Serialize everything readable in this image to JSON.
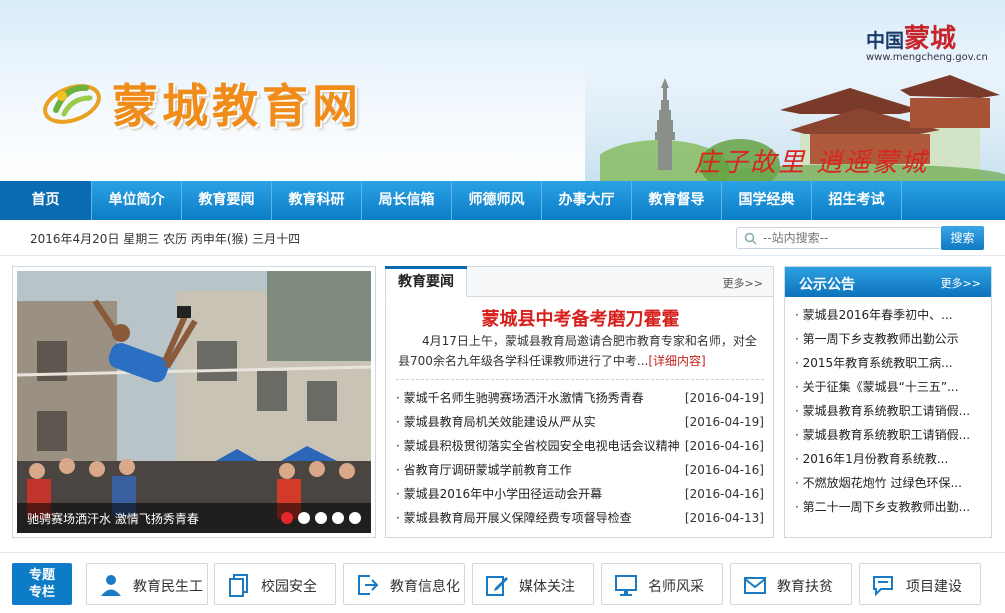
{
  "header": {
    "site_title": "蒙城教育网",
    "china_logo_prefix": "中国",
    "china_logo_name": "蒙城",
    "china_logo_url": "www.mengcheng.gov.cn",
    "slogan": "庄子故里  逍遥蒙城"
  },
  "nav": {
    "items": [
      "首页",
      "单位简介",
      "教育要闻",
      "教育科研",
      "局长信箱",
      "师德师风",
      "办事大厅",
      "教育督导",
      "国学经典",
      "招生考试"
    ],
    "active": "首页"
  },
  "datebar": {
    "date_text": "2016年4月20日 星期三 农历 丙申年(猴) 三月十四",
    "search_placeholder": "--站内搜索--",
    "search_button": "搜索"
  },
  "slideshow": {
    "caption": "驰骋赛场洒汗水 激情飞扬秀青春",
    "slide_count": 5,
    "active_slide": 1
  },
  "news": {
    "tab_label": "教育要闻",
    "more_label": "更多>>",
    "headline": "蒙城县中考备考磨刀霍霍",
    "summary": "4月17日上午，蒙城县教育局邀请合肥市教育专家和名师，对全县700余名九年级各学科任课教师进行了中考...",
    "detail_link": "[详细内容]",
    "items": [
      {
        "title": "蒙城千名师生驰骋赛场洒汗水激情飞扬秀青春",
        "date": "[2016-04-19]"
      },
      {
        "title": "蒙城县教育局机关效能建设从严从实",
        "date": "[2016-04-19]"
      },
      {
        "title": "蒙城县积极贯彻落实全省校园安全电视电话会议精神",
        "date": "[2016-04-16]"
      },
      {
        "title": "省教育厅调研蒙城学前教育工作",
        "date": "[2016-04-16]"
      },
      {
        "title": "蒙城县2016年中小学田径运动会开幕",
        "date": "[2016-04-16]"
      },
      {
        "title": "蒙城县教育局开展义保障经费专项督导检查",
        "date": "[2016-04-13]"
      }
    ]
  },
  "notice": {
    "title": "公示公告",
    "more_label": "更多>>",
    "items": [
      "蒙城县2016年春季初中、...",
      "第一周下乡支教教师出勤公示",
      "2015年教育系统教职工病...",
      "关于征集《蒙城县“十三五”...",
      "蒙城县教育系统教职工请销假...",
      "蒙城县教育系统教职工请销假...",
      "2016年1月份教育系统教...",
      "不燃放烟花炮竹 过绿色环保...",
      "第二十一周下乡支教教师出勤..."
    ]
  },
  "special": {
    "label_line1": "专题",
    "label_line2": "专栏",
    "topics": [
      {
        "label": "教育民生工",
        "icon": "person-icon"
      },
      {
        "label": "校园安全",
        "icon": "documents-icon"
      },
      {
        "label": "教育信息化",
        "icon": "export-icon"
      },
      {
        "label": "媒体关注",
        "icon": "edit-icon"
      },
      {
        "label": "名师风采",
        "icon": "monitor-icon"
      },
      {
        "label": "教育扶贫",
        "icon": "envelope-icon"
      },
      {
        "label": "项目建设",
        "icon": "chat-icon"
      }
    ]
  },
  "colors": {
    "nav_blue": "#0c7cc7",
    "title_orange": "#f08c1a",
    "headline_red": "#d7201c"
  }
}
